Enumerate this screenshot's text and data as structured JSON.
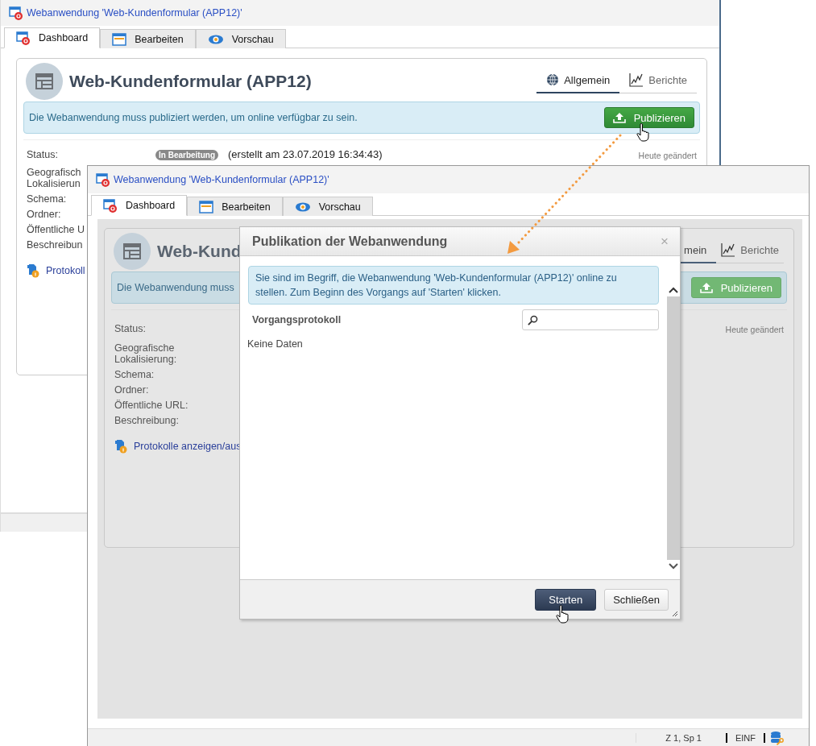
{
  "windows": [
    {
      "title": "Webanwendung 'Web-Kundenformular (APP12)'",
      "tabs": [
        {
          "label": "Dashboard",
          "selected": true
        },
        {
          "label": "Bearbeiten",
          "selected": false
        },
        {
          "label": "Vorschau",
          "selected": false
        }
      ],
      "dashboard": {
        "heading": "Web-Kundenformular (APP12)",
        "view_tabs": [
          {
            "label": "Allgemein",
            "selected": true
          },
          {
            "label": "Berichte",
            "selected": false
          }
        ],
        "banner": {
          "text": "Die Webanwendung muss publiziert werden, um online verfügbar zu sein.",
          "button": "Publizieren"
        },
        "status": {
          "label": "Status:",
          "badge": "In Bearbeitung",
          "created": "(erstellt am 23.07.2019 16:34:43)"
        },
        "modified": "Heute geändert",
        "fields": [
          "Geografisch\nLokalisierun",
          "Schema:",
          "Ordner:",
          "Öffentliche U",
          "Beschreibun"
        ],
        "log_link": "Protokoll"
      }
    },
    {
      "title": "Webanwendung 'Web-Kundenformular (APP12)'",
      "tabs": [
        {
          "label": "Dashboard",
          "selected": true
        },
        {
          "label": "Bearbeiten",
          "selected": false
        },
        {
          "label": "Vorschau",
          "selected": false
        }
      ],
      "dashboard": {
        "heading": "Web-Kund",
        "view_tabs": [
          {
            "label": "mein",
            "selected": true
          },
          {
            "label": "Berichte",
            "selected": false
          }
        ],
        "banner": {
          "text": "Die Webanwendung muss",
          "button": "Publizieren"
        },
        "status": {
          "label": "Status:"
        },
        "modified": "Heute geändert",
        "fields": [
          "Geografische\nLokalisierung:",
          "Schema:",
          "Ordner:",
          "Öffentliche URL:",
          "Beschreibung:"
        ],
        "log_link": "Protokolle anzeigen/aus"
      }
    }
  ],
  "dialog": {
    "title": "Publikation der Webanwendung",
    "close": "×",
    "message": "Sie sind im Begriff, die Webanwendung 'Web-Kundenformular (APP12)' online zu stellen. Zum Beginn des Vorgangs auf 'Starten' klicken.",
    "log_title": "Vorgangsprotokoll",
    "empty": "Keine Daten",
    "buttons": [
      {
        "label": "Starten",
        "kind": "primary"
      },
      {
        "label": "Schließen",
        "kind": "secondary"
      }
    ]
  },
  "status_bar": {
    "position": "Z 1, Sp 1",
    "mode": "EINF"
  }
}
